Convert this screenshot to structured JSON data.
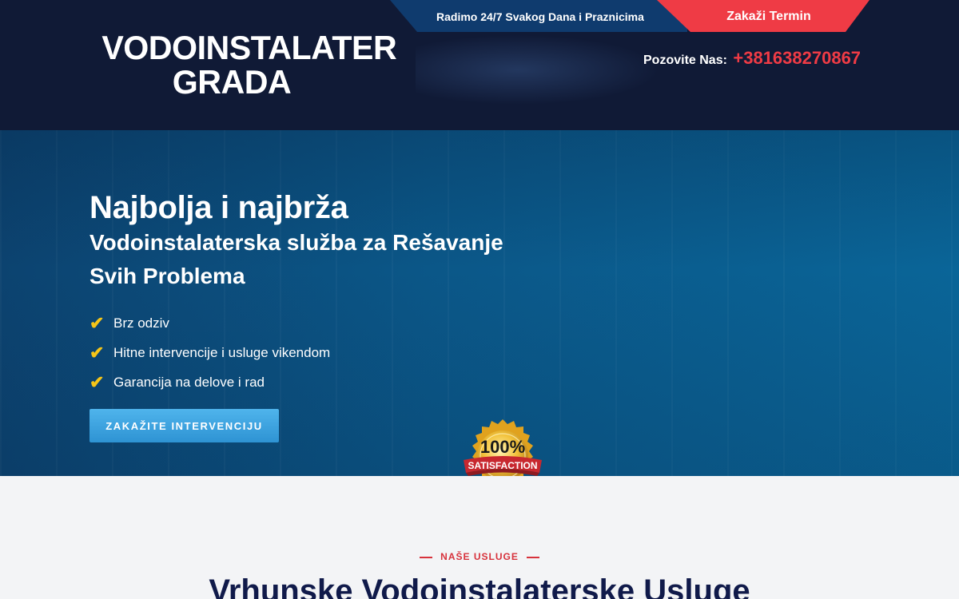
{
  "header": {
    "logo_line1": "VODOINSTALATER",
    "logo_line2": "GRADA",
    "availability": "Radimo 24/7 Svakog Dana i Praznicima",
    "book_button": "Zakaži Termin",
    "call_label": "Pozovite Nas:",
    "phone": "+381638270867"
  },
  "hero": {
    "title": "Najbolja i najbrža",
    "subtitle": "Vodoinstalaterska služba za Rešavanje Svih Problema",
    "features": [
      "Brz odziv",
      "Hitne intervencije i usluge vikendom",
      "Garancija na delove i rad"
    ],
    "cta": "ZAKAŽITE INTERVENCIJU",
    "badge_top": "100%",
    "badge_ribbon": "SATISFACTION"
  },
  "services": {
    "eyebrow": "NAŠE USLUGE",
    "title": "Vrhunske Vodoinstalaterske Usluge"
  },
  "colors": {
    "header_bg": "#101a36",
    "accent_red": "#ef3b45",
    "topbar_blue": "#0f3b6e",
    "check_yellow": "#f5c518",
    "cta_blue": "#3aa3e0",
    "title_navy": "#101a4a"
  }
}
